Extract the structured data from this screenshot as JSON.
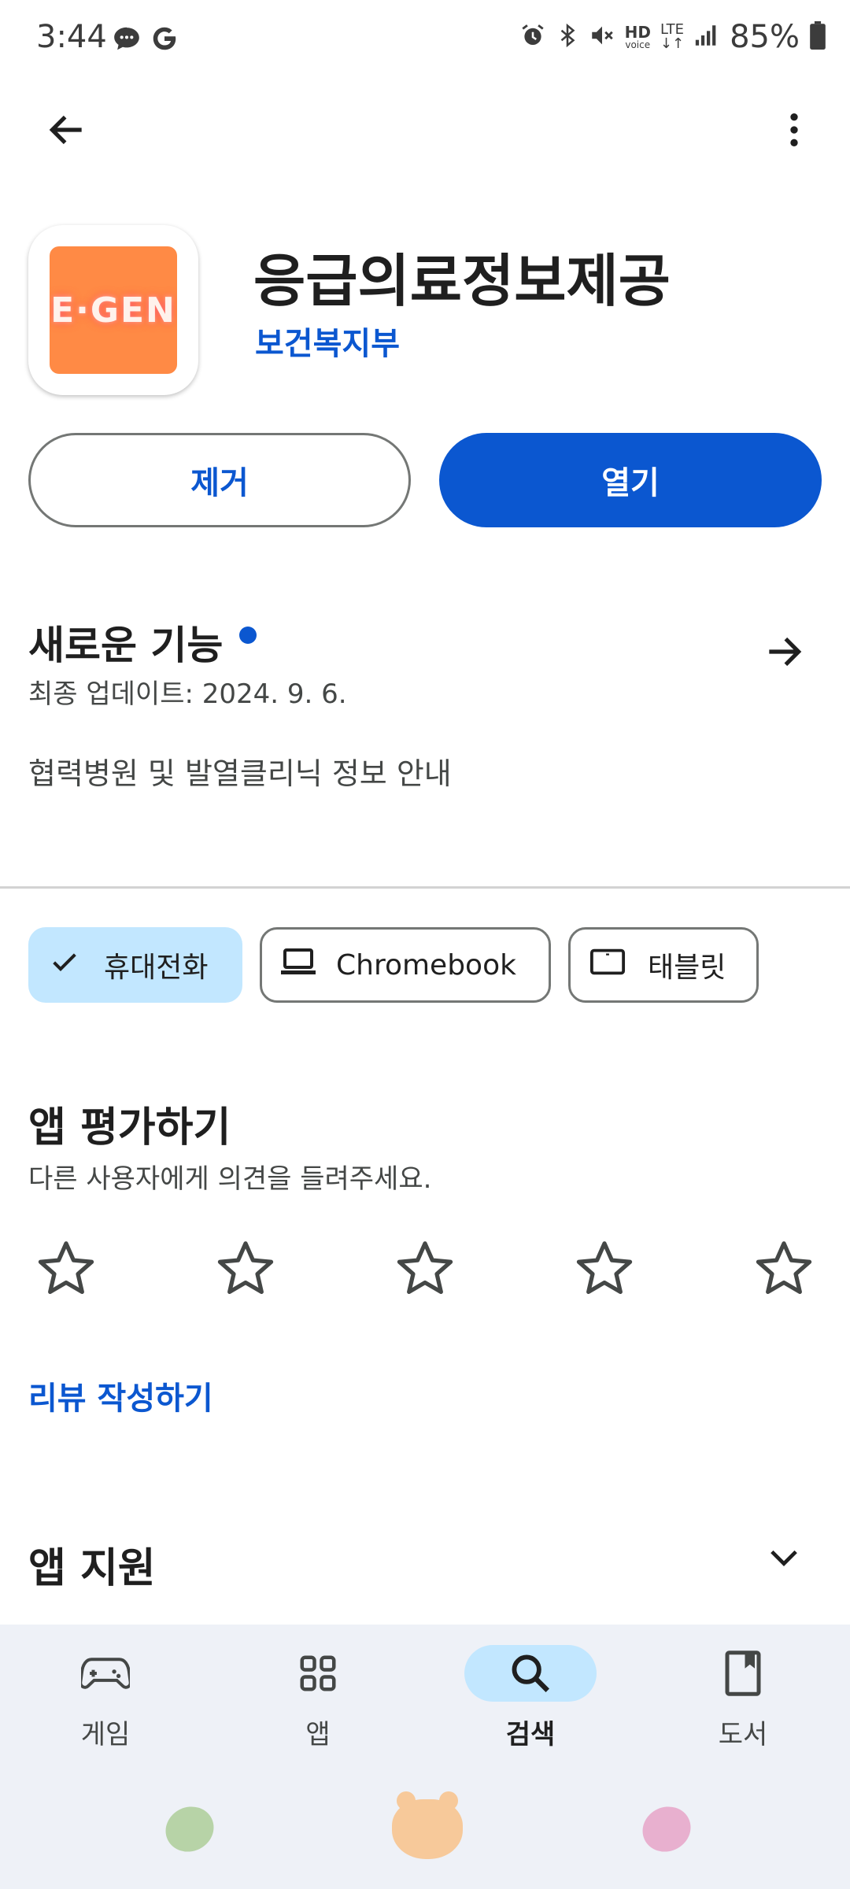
{
  "status_bar": {
    "time": "3:44",
    "battery_percent": "85%",
    "icons_left": [
      "chat-bubble-icon",
      "google-g-icon"
    ],
    "icons_right": [
      "alarm-icon",
      "bluetooth-icon",
      "mute-icon",
      "hd-voice-icon",
      "lte-icon",
      "signal-icon",
      "battery-icon"
    ],
    "hd_text": "HD",
    "voice_text": "voice",
    "lte_text": "LTE"
  },
  "app": {
    "title": "응급의료정보제공",
    "developer": "보건복지부",
    "icon_text": "E·GEN",
    "icon_color": "#ff8a45"
  },
  "actions": {
    "uninstall_label": "제거",
    "open_label": "열기",
    "accent_color": "#0b57d0"
  },
  "whats_new": {
    "title": "새로운 기능",
    "last_updated": "최종 업데이트: 2024. 9. 6.",
    "body": "협력병원 및 발열클리닉 정보 안내"
  },
  "device_chips": [
    {
      "label": "휴대전화",
      "icon": "check-icon",
      "selected": true
    },
    {
      "label": "Chromebook",
      "icon": "laptop-icon",
      "selected": false
    },
    {
      "label": "태블릿",
      "icon": "tablet-icon",
      "selected": false
    }
  ],
  "rate": {
    "title": "앱 평가하기",
    "subtitle": "다른 사용자에게 의견을 들려주세요.",
    "stars_total": 5,
    "stars_filled": 0,
    "write_review_label": "리뷰 작성하기"
  },
  "support": {
    "title": "앱 지원"
  },
  "bottom_nav": {
    "items": [
      {
        "label": "게임",
        "icon": "gamepad-icon",
        "active": false
      },
      {
        "label": "앱",
        "icon": "apps-grid-icon",
        "active": false
      },
      {
        "label": "검색",
        "icon": "search-icon",
        "active": true
      },
      {
        "label": "도서",
        "icon": "book-icon",
        "active": false
      }
    ]
  }
}
